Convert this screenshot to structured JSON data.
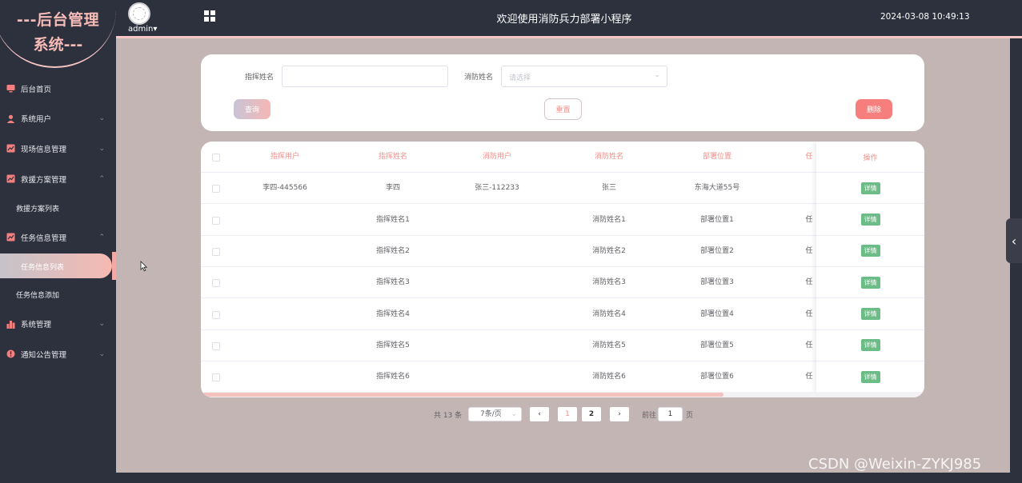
{
  "brand": {
    "line1": "---后台管理",
    "line2": "系统---"
  },
  "header": {
    "user": "admin",
    "user_caret": "▾",
    "title": "欢迎使用消防兵力部署小程序",
    "datetime": "2024-03-08 10:49:13"
  },
  "sidebar": {
    "items": [
      {
        "label": "后台首页",
        "icon": "monitor-icon",
        "chevron": ""
      },
      {
        "label": "系统用户",
        "icon": "user-icon",
        "chevron": "⌄"
      },
      {
        "label": "现场信息管理",
        "icon": "chart-icon",
        "chevron": "⌄"
      },
      {
        "label": "救援方案管理",
        "icon": "chart-icon",
        "chevron": "⌃"
      },
      {
        "label": "救援方案列表"
      },
      {
        "label": "任务信息管理",
        "icon": "chart-icon",
        "chevron": "⌃"
      },
      {
        "label": "任务信息列表"
      },
      {
        "label": "任务信息添加"
      },
      {
        "label": "系统管理",
        "icon": "bar-chart-icon",
        "chevron": "⌄"
      },
      {
        "label": "通知公告管理",
        "icon": "info-icon",
        "chevron": "⌄"
      }
    ]
  },
  "search": {
    "commander_label": "指挥姓名",
    "commander_value": "",
    "fire_label": "消防姓名",
    "fire_placeholder": "请选择",
    "select_arrow": "⌄",
    "query_label": "查询",
    "reset_label": "重置",
    "delete_label": "删除"
  },
  "table": {
    "headers": [
      "指挥用户",
      "指挥姓名",
      "消防用户",
      "消防姓名",
      "部署位置",
      "任",
      "操作"
    ],
    "rows": [
      {
        "commander_user": "李四-445566",
        "commander_name": "李四",
        "fire_user": "张三-112233",
        "fire_name": "张三",
        "location": "东海大道55号",
        "task": "",
        "action": "详情"
      },
      {
        "commander_user": "",
        "commander_name": "指挥姓名1",
        "fire_user": "",
        "fire_name": "消防姓名1",
        "location": "部署位置1",
        "task": "任",
        "action": "详情"
      },
      {
        "commander_user": "",
        "commander_name": "指挥姓名2",
        "fire_user": "",
        "fire_name": "消防姓名2",
        "location": "部署位置2",
        "task": "任",
        "action": "详情"
      },
      {
        "commander_user": "",
        "commander_name": "指挥姓名3",
        "fire_user": "",
        "fire_name": "消防姓名3",
        "location": "部署位置3",
        "task": "任",
        "action": "详情"
      },
      {
        "commander_user": "",
        "commander_name": "指挥姓名4",
        "fire_user": "",
        "fire_name": "消防姓名4",
        "location": "部署位置4",
        "task": "任",
        "action": "详情"
      },
      {
        "commander_user": "",
        "commander_name": "指挥姓名5",
        "fire_user": "",
        "fire_name": "消防姓名5",
        "location": "部署位置5",
        "task": "任",
        "action": "详情"
      },
      {
        "commander_user": "",
        "commander_name": "指挥姓名6",
        "fire_user": "",
        "fire_name": "消防姓名6",
        "location": "部署位置6",
        "task": "任",
        "action": "详情"
      }
    ]
  },
  "pagination": {
    "total": "共 13 条",
    "page_size": "7条/页",
    "size_arrow": "⌄",
    "prev": "‹",
    "next": "›",
    "page1": "1",
    "page2": "2",
    "goto_label": "前往",
    "goto_value": "1",
    "goto_unit": "页"
  },
  "side_tab_glyph": "‹",
  "watermark": "CSDN @Weixin-ZYKJ985",
  "colors": {
    "sidebar_bg": "#2d303d",
    "main_bg": "#c4b5b5",
    "accent_pink": "#f08f8a",
    "delete_red": "#f67f7d",
    "detail_green": "#6bbc86"
  }
}
